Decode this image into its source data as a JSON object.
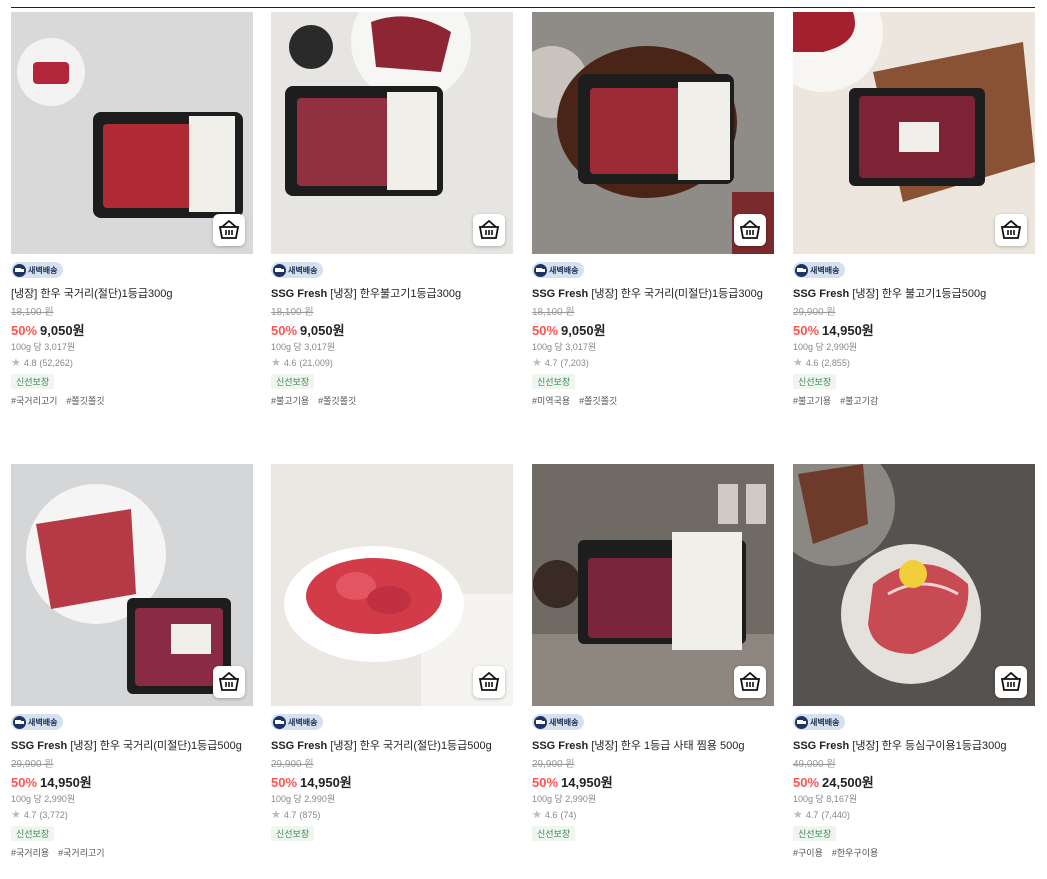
{
  "delivery_badge": "새벽배송",
  "brand": "SSG Fresh",
  "fresh_guarantee": "신선보장",
  "colors": {
    "discount": "#ff5452",
    "badge_bg": "#d6e1ef",
    "fresh_bg": "#eef6ef"
  },
  "products": [
    {
      "brand": "",
      "name": "[냉장] 한우 국거리(절단)1등급300g",
      "original_price": "18,100 원",
      "discount": "50%",
      "price": "9,050원",
      "unit_price": "100g 당 3,017원",
      "rating": "4.8",
      "reviews": "(52,262)",
      "tags": [
        "#국거리고기",
        "#쫄깃쫄깃"
      ]
    },
    {
      "brand": "SSG Fresh",
      "name": "[냉장] 한우불고기1등급300g",
      "original_price": "18,100 원",
      "discount": "50%",
      "price": "9,050원",
      "unit_price": "100g 당 3,017원",
      "rating": "4.6",
      "reviews": "(21,009)",
      "tags": [
        "#불고기용",
        "#쫄깃쫄깃"
      ]
    },
    {
      "brand": "SSG Fresh",
      "name": "[냉장] 한우 국거리(미절단)1등급300g",
      "original_price": "18,100 원",
      "discount": "50%",
      "price": "9,050원",
      "unit_price": "100g 당 3,017원",
      "rating": "4.7",
      "reviews": "(7,203)",
      "tags": [
        "#미역국용",
        "#쫄깃쫄깃"
      ]
    },
    {
      "brand": "SSG Fresh",
      "name": "[냉장] 한우 불고기1등급500g",
      "original_price": "29,900 원",
      "discount": "50%",
      "price": "14,950원",
      "unit_price": "100g 당 2,990원",
      "rating": "4.6",
      "reviews": "(2,855)",
      "tags": [
        "#불고기용",
        "#불고기감"
      ]
    },
    {
      "brand": "SSG Fresh",
      "name": "[냉장] 한우 국거리(미절단)1등급500g",
      "original_price": "29,900 원",
      "discount": "50%",
      "price": "14,950원",
      "unit_price": "100g 당 2,990원",
      "rating": "4.7",
      "reviews": "(3,772)",
      "tags": [
        "#국거리용",
        "#국거리고기"
      ]
    },
    {
      "brand": "SSG Fresh",
      "name": "[냉장] 한우 국거리(절단)1등급500g",
      "original_price": "29,900 원",
      "discount": "50%",
      "price": "14,950원",
      "unit_price": "100g 당 2,990원",
      "rating": "4.7",
      "reviews": "(875)",
      "tags": []
    },
    {
      "brand": "SSG Fresh",
      "name": "[냉장] 한우 1등급 사태 찜용 500g",
      "original_price": "29,900 원",
      "discount": "50%",
      "price": "14,950원",
      "unit_price": "100g 당 2,990원",
      "rating": "4.6",
      "reviews": "(74)",
      "tags": []
    },
    {
      "brand": "SSG Fresh",
      "name": "[냉장] 한우 등심구이용1등급300g",
      "original_price": "49,000 원",
      "discount": "50%",
      "price": "24,500원",
      "unit_price": "100g 당 8,167원",
      "rating": "4.7",
      "reviews": "(7,440)",
      "tags": [
        "#구이용",
        "#한우구이용"
      ]
    }
  ],
  "images": [
    {
      "bg": "#d9d9d9",
      "icon": "beef-pack-image"
    },
    {
      "bg": "#e7e5e2",
      "icon": "beef-pack-image"
    },
    {
      "bg": "#8f8b86",
      "icon": "beef-pack-image"
    },
    {
      "bg": "#ece6de",
      "icon": "beef-pack-image"
    },
    {
      "bg": "#d5d6d8",
      "icon": "beef-pack-image"
    },
    {
      "bg": "#ebe7e2",
      "icon": "beef-bowl-image"
    },
    {
      "bg": "#6f6a64",
      "icon": "beef-pack-image"
    },
    {
      "bg": "#55524f",
      "icon": "steak-plate-image"
    }
  ]
}
